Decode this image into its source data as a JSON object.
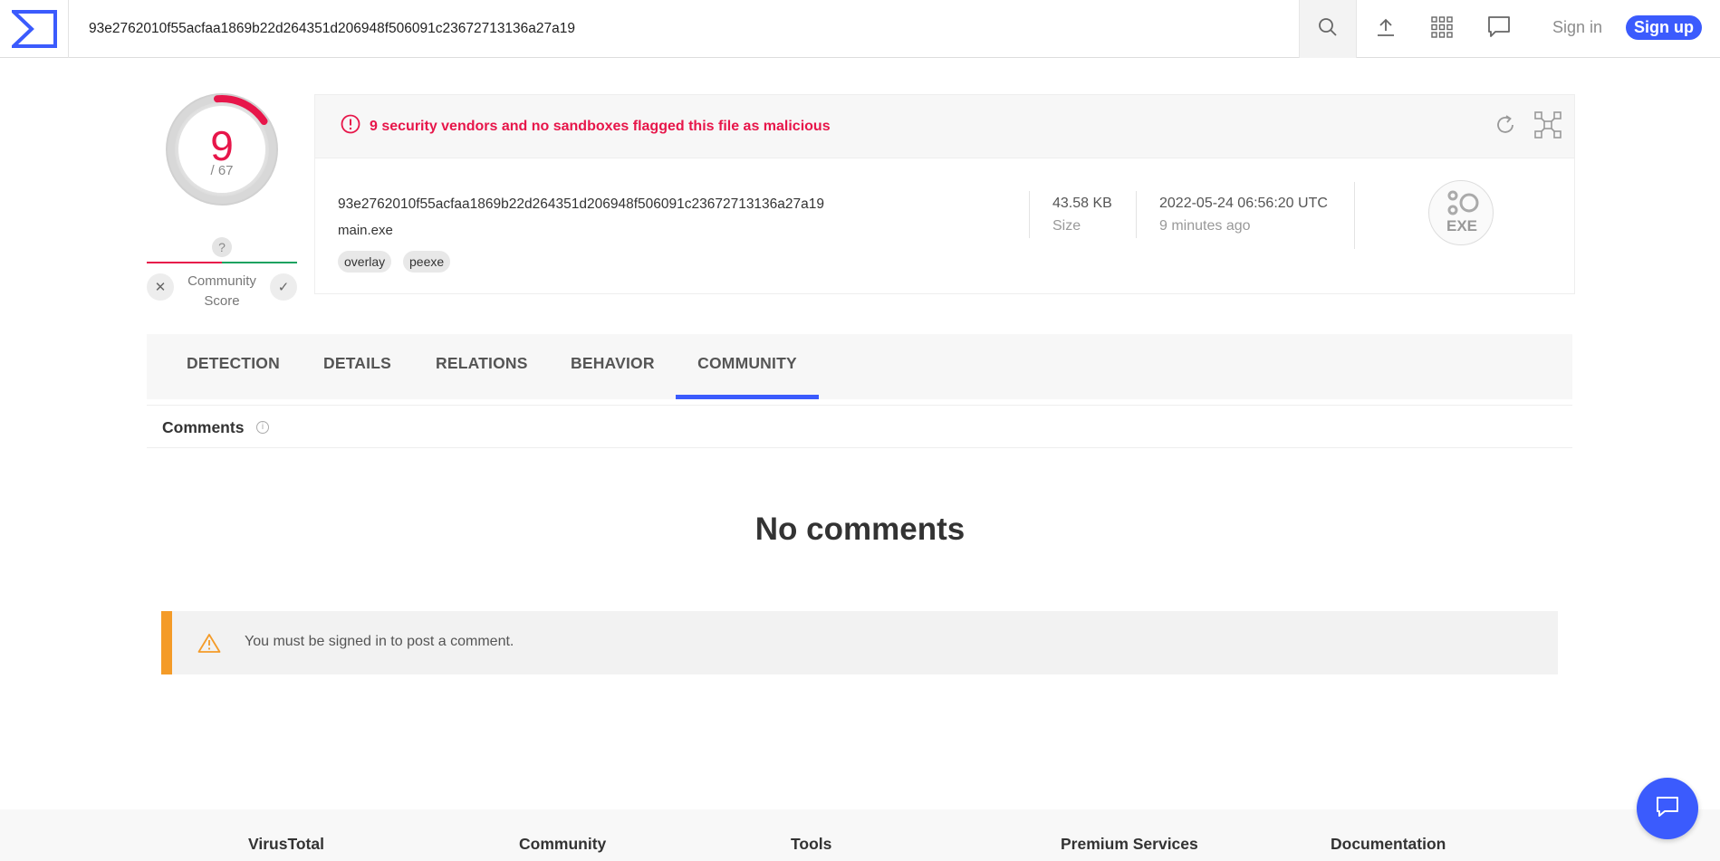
{
  "header": {
    "search_value": "93e2762010f55acfaa1869b22d264351d206948f506091c23672713136a27a19",
    "sign_in": "Sign in",
    "sign_up": "Sign up"
  },
  "score": {
    "detections": "9",
    "total": "/ 67",
    "community_question": "?",
    "community_label_line1": "Community",
    "community_label_line2": "Score"
  },
  "file": {
    "alert": "9 security vendors and no sandboxes flagged this file as malicious",
    "hash": "93e2762010f55acfaa1869b22d264351d206948f506091c23672713136a27a19",
    "name": "main.exe",
    "tags": [
      "overlay",
      "peexe"
    ],
    "size_value": "43.58 KB",
    "size_label": "Size",
    "date_value": "2022-05-24 06:56:20 UTC",
    "date_relative": "9 minutes ago",
    "type_label": "EXE"
  },
  "tabs": [
    "DETECTION",
    "DETAILS",
    "RELATIONS",
    "BEHAVIOR",
    "COMMUNITY"
  ],
  "active_tab": "COMMUNITY",
  "comments": {
    "title": "Comments",
    "empty": "No comments",
    "signin_notice": "You must be signed in to post a comment."
  },
  "footer": {
    "columns": [
      "VirusTotal",
      "Community",
      "Tools",
      "Premium Services",
      "Documentation"
    ]
  },
  "colors": {
    "brand": "#3b5bfd",
    "malicious": "#e7164a",
    "warning": "#f49b28"
  }
}
